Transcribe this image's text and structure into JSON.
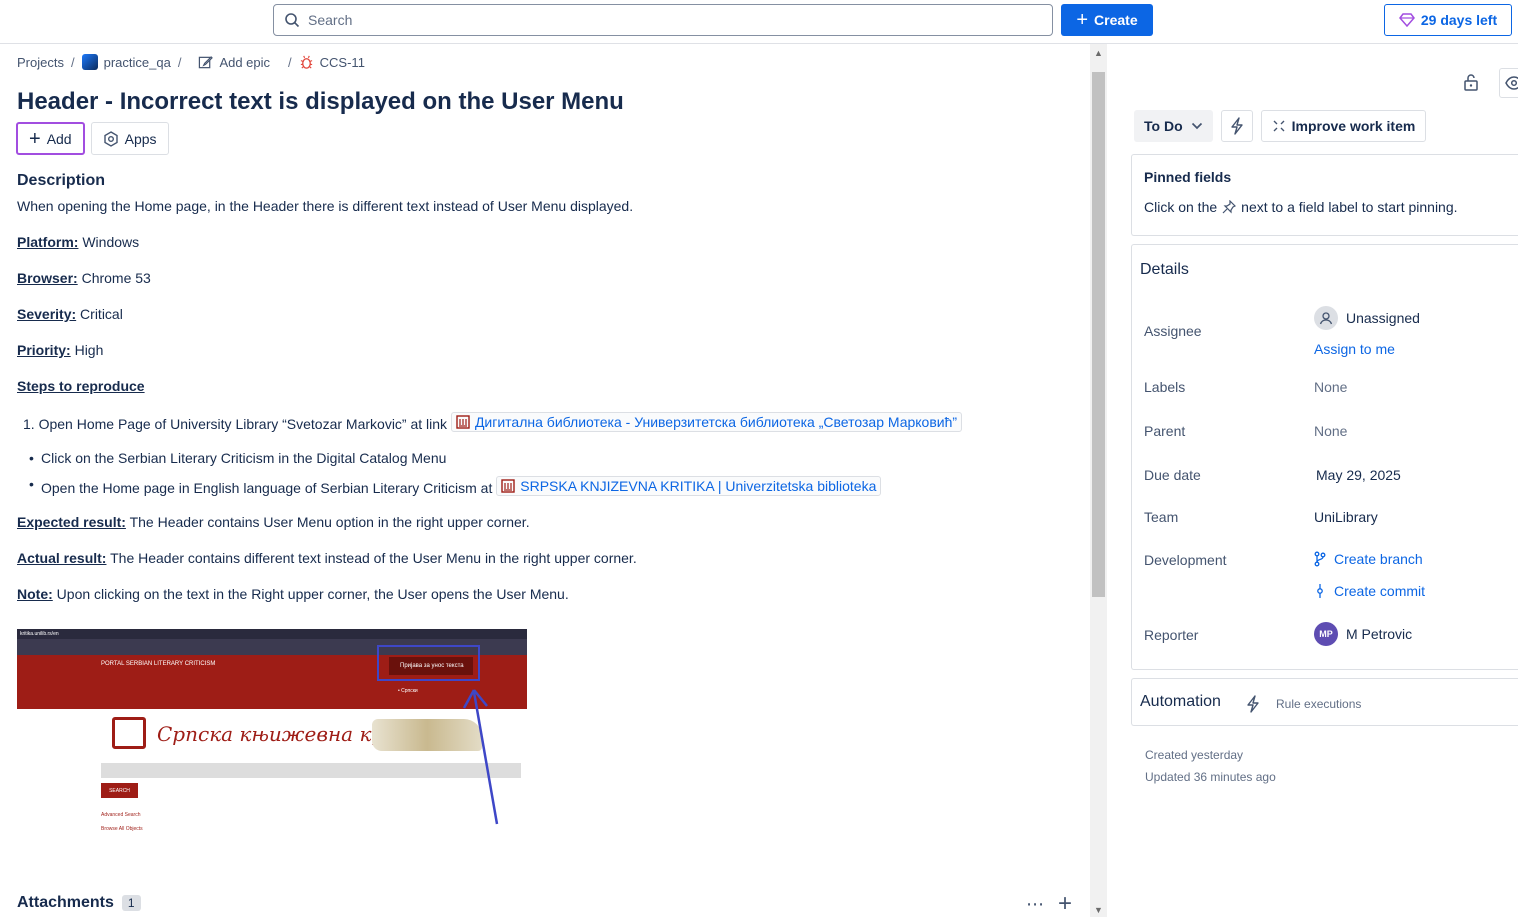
{
  "topbar": {
    "search_placeholder": "Search",
    "create_label": "Create",
    "trial_label": "29 days left"
  },
  "breadcrumb": {
    "projects": "Projects",
    "project": "practice_qa",
    "add_epic": "Add epic",
    "issue_key": "CCS-11"
  },
  "issue": {
    "title": "Header - Incorrect text is displayed on the User Menu",
    "add_label": "Add",
    "apps_label": "Apps"
  },
  "description": {
    "heading": "Description",
    "intro": "When opening the Home page, in the Header there is different text instead of User Menu displayed.",
    "platform_label": "Platform:",
    "platform_value": " Windows",
    "browser_label": "Browser:",
    "browser_value": " Chrome 53",
    "severity_label": "Severity:",
    "severity_value": " Critical",
    "priority_label": "Priority:",
    "priority_value": " High",
    "steps_label": "Steps to reproduce",
    "step1_num": "1.",
    "step1_text": "Open Home Page of University Library “Svetozar Markovic” at link ",
    "step1_link": "Дигитална библиотека - Универзитетска библиотека „Светозар Марковић”",
    "step2_text": "Click on the Serbian Literary Criticism in the Digital Catalog Menu",
    "step3_text": "Open the Home page in English language of Serbian Literary Criticism at ",
    "step3_link": "SRPSKA KNJIZEVNA KRITIKA | Univerzitetska biblioteka",
    "expected_label": "Expected result:",
    "expected_value": " The Header contains User Menu option in the right upper corner.",
    "actual_label": "Actual result:",
    "actual_value": " The Header contains different text instead of the User Menu in the right upper corner.",
    "note_label": "Note:",
    "note_value": " Upon clicking on the text in the Right upper corner, the User opens the User Menu."
  },
  "screenshot": {
    "url_text": "kritika.unilib.rs/en",
    "portal_text": "PORTAL SERBIAN LITERARY CRITICISM",
    "login_text": "Пријава за унос текста",
    "menu_item": "Српски",
    "logo_text": "Српска књижевна критика",
    "search_btn": "SEARCH",
    "advanced_link": "Advanced Search",
    "browse_link": "Browse All Objects"
  },
  "attachments": {
    "title": "Attachments",
    "count": "1"
  },
  "side": {
    "status_label": "To Do",
    "improve_label": "Improve work item",
    "pinned_title": "Pinned fields",
    "pinned_before": "Click on the",
    "pinned_after": "next to a field label to start pinning.",
    "details_title": "Details",
    "assignee_label": "Assignee",
    "assignee_value": "Unassigned",
    "assign_to_me": "Assign to me",
    "labels_label": "Labels",
    "labels_value": "None",
    "parent_label": "Parent",
    "parent_value": "None",
    "due_label": "Due date",
    "due_value": "May 29, 2025",
    "team_label": "Team",
    "team_value": "UniLibrary",
    "dev_label": "Development",
    "create_branch": "Create branch",
    "create_commit": "Create commit",
    "reporter_label": "Reporter",
    "reporter_initials": "MP",
    "reporter_value": "M Petrovic",
    "automation_title": "Automation",
    "rule_executions": "Rule executions",
    "created": "Created yesterday",
    "updated": "Updated 36 minutes ago"
  },
  "colors": {
    "accent": "#0c66e4",
    "focus": "#a24de0",
    "avatar": "#5e4db2"
  }
}
